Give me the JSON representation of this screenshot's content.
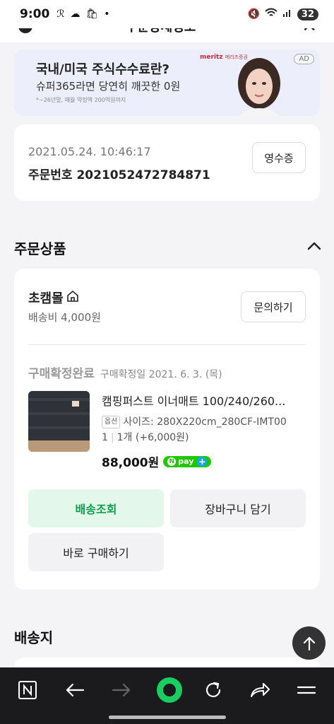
{
  "status_bar": {
    "time": "9:00",
    "battery": "32"
  },
  "header": {
    "title": "주문상세정보"
  },
  "ad": {
    "title": "국내/미국 주식수수료란?",
    "subtitle": "슈퍼365라면 당연히 깨끗한 0원",
    "note": "*~26년말, 매월 약정액 200억원까지",
    "brand": "meritz",
    "brand_sub": "메리츠증권",
    "badge": "AD"
  },
  "order": {
    "date": "2021.05.24. 10:46:17",
    "number": "주문번호 2021052472784871",
    "receipt_label": "영수증"
  },
  "products_section": {
    "title": "주문상품"
  },
  "seller": {
    "name": "초캠몰",
    "shipping_fee": "배송비 4,000원",
    "inquire_label": "문의하기"
  },
  "item": {
    "status": "구매확정완료",
    "confirm_date": "구매확정일 2021. 6. 3. (목)",
    "name": "캠핑퍼스트 이너매트 100/240/260...",
    "option_tag": "옵션",
    "option_text": "사이즈: 280X220cm_280CF-IMT00",
    "option_text_2": "1",
    "quantity": "1개 (+6,000원)",
    "price": "88,000원",
    "npay_label": "pay",
    "npay_n": "N"
  },
  "actions": {
    "delivery": "배송조회",
    "cart": "장바구니 담기",
    "buy_now": "바로 구매하기"
  },
  "address_section": {
    "title": "배송지"
  },
  "colors": {
    "accent_green": "#0e9f4c",
    "npay_green": "#1ec800",
    "nav_bg": "#1b1b1e"
  }
}
